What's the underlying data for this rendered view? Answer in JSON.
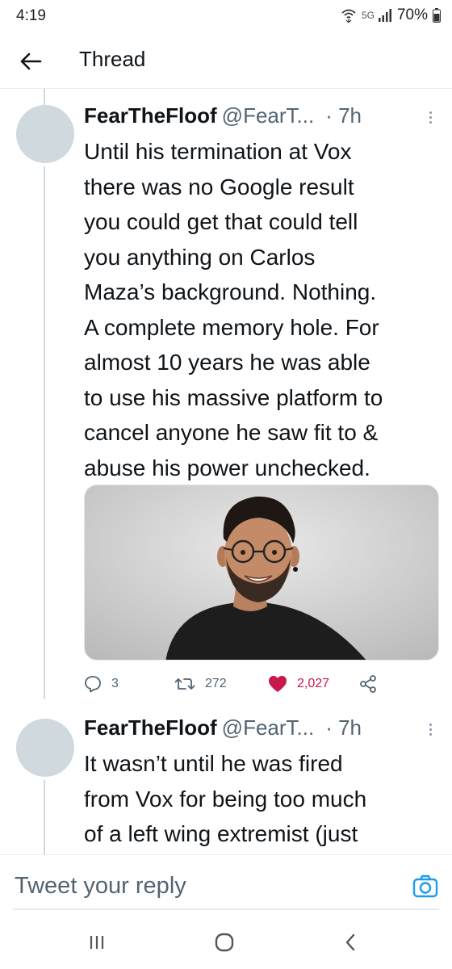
{
  "status_bar": {
    "time": "4:19",
    "network": "5G",
    "battery": "70%",
    "icons": [
      "wifi-icon",
      "signal-icon",
      "battery-icon"
    ]
  },
  "header": {
    "title": "Thread",
    "back_icon": "arrow-left-icon"
  },
  "tweets": [
    {
      "name": "FearTheFloof",
      "handle": "@FearT...",
      "time": "· 7h",
      "lines": [
        "Until his termination at Vox",
        "there was no Google result",
        "you could get that could tell",
        "you anything on Carlos",
        "Maza’s background. Nothing.",
        "A complete memory hole. For",
        "almost 10 years he was able",
        "to use his massive platform to",
        "cancel anyone he saw fit to &",
        "abuse his power unchecked."
      ],
      "has_media": true,
      "actions": {
        "replies": "3",
        "retweets": "272",
        "likes": "2,027"
      }
    },
    {
      "name": "FearTheFloof",
      "handle": "@FearT...",
      "time": "· 7h",
      "lines": [
        "It wasn’t until he was fired",
        "from Vox for being too much",
        "of a left wing extremist (just"
      ]
    }
  ],
  "reply_bar": {
    "placeholder": "Tweet your reply",
    "camera_icon": "camera-icon"
  },
  "nav_bar": {
    "items": [
      "recents-icon",
      "home-icon",
      "back-icon"
    ]
  },
  "colors": {
    "like": "#c9184a",
    "accent": "#1d9bf0",
    "muted": "#536471",
    "avatar": "#cfd9de"
  }
}
